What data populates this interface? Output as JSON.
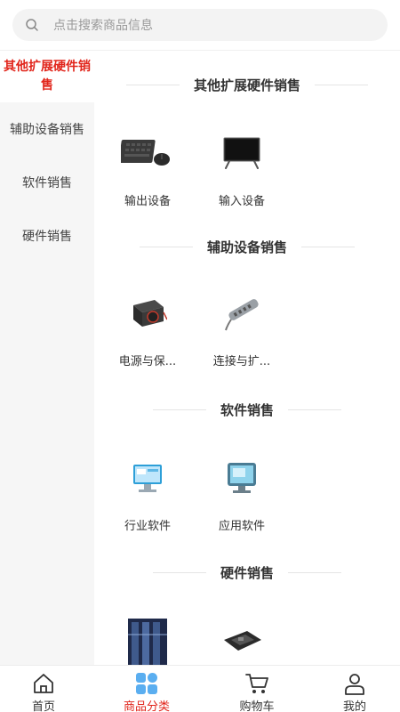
{
  "search": {
    "placeholder": "点击搜索商品信息"
  },
  "sidebar": {
    "items": [
      {
        "label": "其他扩展硬件销售"
      },
      {
        "label": "辅助设备销售"
      },
      {
        "label": "软件销售"
      },
      {
        "label": "硬件销售"
      }
    ]
  },
  "sections": [
    {
      "title": "其他扩展硬件销售",
      "items": [
        {
          "label": "输出设备",
          "icon": "keyboard-mouse-image"
        },
        {
          "label": "输入设备",
          "icon": "monitor-image"
        }
      ]
    },
    {
      "title": "辅助设备销售",
      "items": [
        {
          "label": "电源与保...",
          "icon": "power-supply-image"
        },
        {
          "label": "连接与扩...",
          "icon": "usb-hub-image"
        }
      ]
    },
    {
      "title": "软件销售",
      "items": [
        {
          "label": "行业软件",
          "icon": "industry-software-image"
        },
        {
          "label": "应用软件",
          "icon": "app-software-image"
        }
      ]
    },
    {
      "title": "硬件销售",
      "items": [
        {
          "icon": "server-rack-image"
        },
        {
          "icon": "motherboard-image"
        }
      ]
    }
  ],
  "tabbar": {
    "items": [
      {
        "label": "首页",
        "icon": "home-icon"
      },
      {
        "label": "商品分类",
        "icon": "category-icon"
      },
      {
        "label": "购物车",
        "icon": "cart-icon"
      },
      {
        "label": "我的",
        "icon": "user-icon"
      }
    ],
    "active": "商品分类"
  },
  "colors": {
    "accent": "#e1251b",
    "category_icon": "#5aaef0"
  }
}
